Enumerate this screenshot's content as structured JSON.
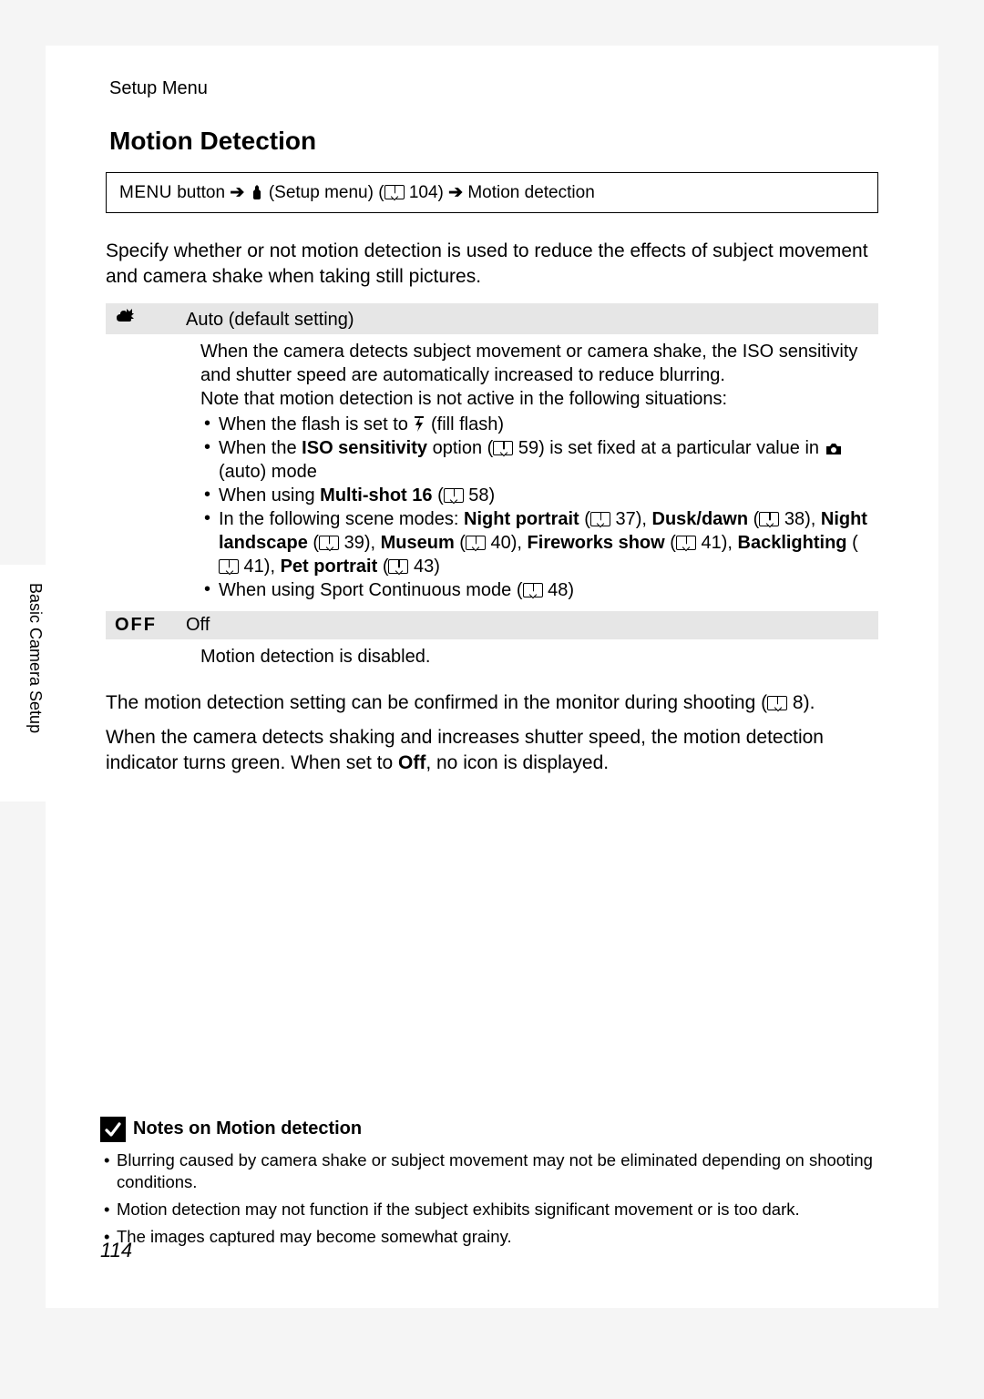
{
  "running_head": "Setup Menu",
  "side_tab": "Basic Camera Setup",
  "page_number": "114",
  "section_title": "Motion Detection",
  "nav": {
    "menu_word": "MENU",
    "button_word": " button ",
    "setup_menu_label": " (Setup menu) (",
    "setup_ref": " 104) ",
    "target": " Motion detection"
  },
  "intro": "Specify whether or not motion detection is used to reduce the effects of subject movement and camera shake when taking still pictures.",
  "options": {
    "auto": {
      "label": "Auto (default setting)",
      "body_line1": "When the camera detects subject movement or camera shake, the ISO sensitivity and shutter speed are automatically increased to reduce blurring.",
      "body_line2": "Note that motion detection is not active in the following situations:",
      "bullets": {
        "b1_pre": "When the flash is set to ",
        "b1_post": " (fill flash)",
        "b2_pre": "When the ",
        "b2_bold": "ISO sensitivity",
        "b2_mid": " option (",
        "b2_ref": " 59) is set fixed at a particular value in ",
        "b2_post": " (auto) mode",
        "b3_pre": "When using ",
        "b3_bold": "Multi-shot 16",
        "b3_mid": " (",
        "b3_ref": " 58)",
        "b4_pre": "In the following scene modes: ",
        "b4_s1": "Night portrait",
        "b4_r1": " 37), ",
        "b4_s2": "Dusk/dawn",
        "b4_r2": " 38), ",
        "b4_s3": "Night landscape",
        "b4_r3": " 39), ",
        "b4_s4": "Museum",
        "b4_r4": " 40), ",
        "b4_s5": "Fireworks show",
        "b4_r5": " 41), ",
        "b4_s6": "Backlighting",
        "b4_r6": " 41), ",
        "b4_s7": "Pet portrait",
        "b4_r7": " 43)",
        "b5_pre": "When using Sport Continuous mode (",
        "b5_ref": " 48)"
      }
    },
    "off": {
      "icon_text": "OFF",
      "label": "Off",
      "body": "Motion detection is disabled."
    }
  },
  "para1_pre": "The motion detection setting can be confirmed in the monitor during shooting (",
  "para1_ref": " 8).",
  "para2_a": "When the camera detects shaking and increases shutter speed, the motion detection indicator turns green. When set to ",
  "para2_bold": "Off",
  "para2_b": ", no icon is displayed.",
  "notes": {
    "title": "Notes on Motion detection",
    "items": [
      "Blurring caused by camera shake or subject movement may not be eliminated depending on shooting conditions.",
      "Motion detection may not function if the subject exhibits significant movement or is too dark.",
      "The images captured may become somewhat grainy."
    ]
  }
}
